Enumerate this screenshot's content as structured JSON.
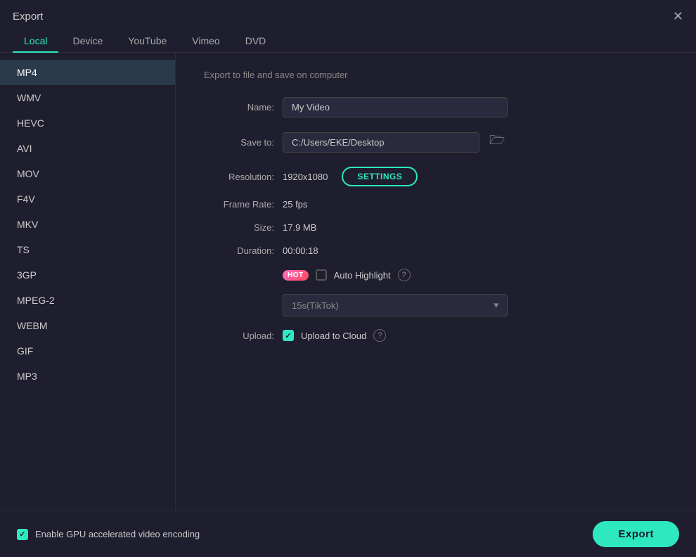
{
  "titleBar": {
    "title": "Export"
  },
  "tabs": [
    {
      "id": "local",
      "label": "Local",
      "active": true
    },
    {
      "id": "device",
      "label": "Device",
      "active": false
    },
    {
      "id": "youtube",
      "label": "YouTube",
      "active": false
    },
    {
      "id": "vimeo",
      "label": "Vimeo",
      "active": false
    },
    {
      "id": "dvd",
      "label": "DVD",
      "active": false
    }
  ],
  "sidebar": {
    "items": [
      {
        "id": "mp4",
        "label": "MP4",
        "active": true
      },
      {
        "id": "wmv",
        "label": "WMV",
        "active": false
      },
      {
        "id": "hevc",
        "label": "HEVC",
        "active": false
      },
      {
        "id": "avi",
        "label": "AVI",
        "active": false
      },
      {
        "id": "mov",
        "label": "MOV",
        "active": false
      },
      {
        "id": "f4v",
        "label": "F4V",
        "active": false
      },
      {
        "id": "mkv",
        "label": "MKV",
        "active": false
      },
      {
        "id": "ts",
        "label": "TS",
        "active": false
      },
      {
        "id": "3gp",
        "label": "3GP",
        "active": false
      },
      {
        "id": "mpeg2",
        "label": "MPEG-2",
        "active": false
      },
      {
        "id": "webm",
        "label": "WEBM",
        "active": false
      },
      {
        "id": "gif",
        "label": "GIF",
        "active": false
      },
      {
        "id": "mp3",
        "label": "MP3",
        "active": false
      }
    ]
  },
  "main": {
    "description": "Export to file and save on computer",
    "form": {
      "nameLabel": "Name:",
      "nameValue": "My Video",
      "saveToLabel": "Save to:",
      "saveToValue": "C:/Users/EKE/Desktop",
      "resolutionLabel": "Resolution:",
      "resolutionValue": "1920x1080",
      "settingsLabel": "SETTINGS",
      "frameRateLabel": "Frame Rate:",
      "frameRateValue": "25 fps",
      "sizeLabel": "Size:",
      "sizeValue": "17.9 MB",
      "durationLabel": "Duration:",
      "durationValue": "00:00:18",
      "hotBadge": "HOT",
      "autoHighlightLabel": "Auto Highlight",
      "tiktokOption": "15s(TikTok)",
      "uploadLabel": "Upload:",
      "uploadToCloudLabel": "Upload to Cloud"
    }
  },
  "footer": {
    "gpuLabel": "Enable GPU accelerated video encoding",
    "exportLabel": "Export"
  },
  "icons": {
    "close": "✕",
    "folder": "🗁",
    "chevronDown": "▾",
    "questionMark": "?",
    "checkmark": "✓"
  }
}
